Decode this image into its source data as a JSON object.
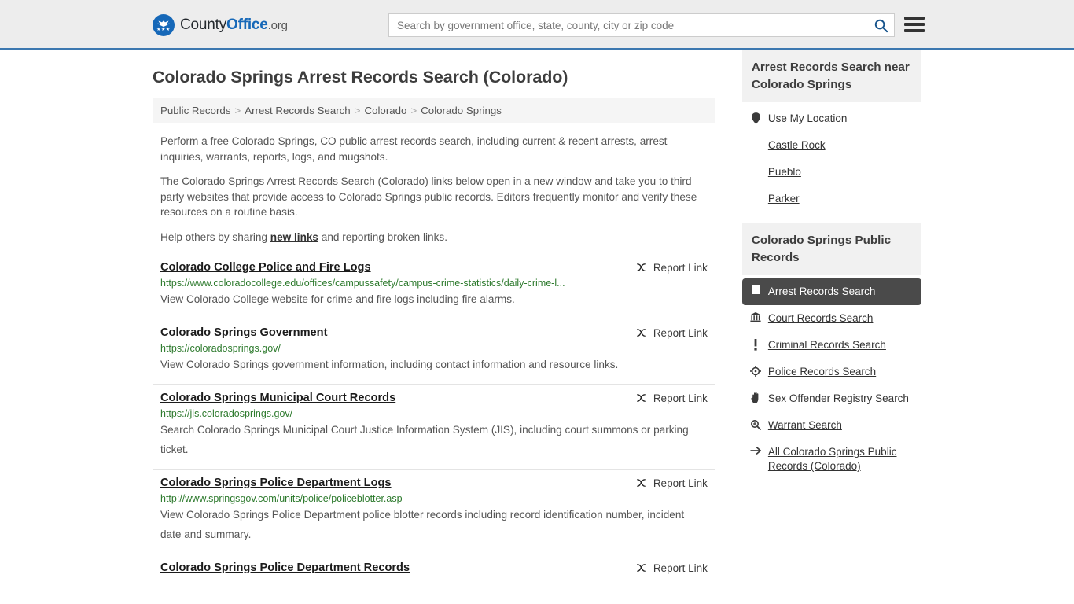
{
  "header": {
    "brand": {
      "part1": "County",
      "part2": "Office",
      "part3": ".org",
      "logo_icon": "eagle-shield-icon",
      "stars": "★★★"
    },
    "search": {
      "placeholder": "Search by government office, state, county, city or zip code",
      "value": "",
      "icon": "search-icon"
    },
    "menu": {
      "icon": "hamburger-menu-icon"
    },
    "accent_color": "#1668b8",
    "border_color": "#3c78b0"
  },
  "main": {
    "title": "Colorado Springs Arrest Records Search (Colorado)",
    "breadcrumb": [
      {
        "label": "Public Records"
      },
      {
        "label": "Arrest Records Search"
      },
      {
        "label": "Colorado"
      },
      {
        "label": "Colorado Springs"
      }
    ],
    "breadcrumb_separator": ">",
    "intro": {
      "p1": "Perform a free Colorado Springs, CO public arrest records search, including current & recent arrests, arrest inquiries, warrants, reports, logs, and mugshots.",
      "p2": "The Colorado Springs Arrest Records Search (Colorado) links below open in a new window and take you to third party websites that provide access to Colorado Springs public records. Editors frequently monitor and verify these resources on a routine basis.",
      "p3_before": "Help others by sharing ",
      "p3_link": "new links",
      "p3_after": " and reporting broken links."
    },
    "report_link_label": "Report Link",
    "report_link_icon": "broken-link-icon",
    "results": [
      {
        "title": "Colorado College Police and Fire Logs",
        "url": "https://www.coloradocollege.edu/offices/campussafety/campus-crime-statistics/daily-crime-l...",
        "description": "View Colorado College website for crime and fire logs including fire alarms."
      },
      {
        "title": "Colorado Springs Government",
        "url": "https://coloradosprings.gov/",
        "description": "View Colorado Springs government information, including contact information and resource links."
      },
      {
        "title": "Colorado Springs Municipal Court Records",
        "url": "https://jis.coloradosprings.gov/",
        "description": "Search Colorado Springs Municipal Court Justice Information System (JIS), including court summons or parking ticket."
      },
      {
        "title": "Colorado Springs Police Department Logs",
        "url": "http://www.springsgov.com/units/police/policeblotter.asp",
        "description": "View Colorado Springs Police Department police blotter records including record identification number, incident date and summary."
      },
      {
        "title": "Colorado Springs Police Department Records",
        "url": "",
        "description": ""
      }
    ]
  },
  "sidebar": {
    "nearby": {
      "heading": "Arrest Records Search near Colorado Springs",
      "items": [
        {
          "label": "Use My Location",
          "icon": "map-pin-icon"
        },
        {
          "label": "Castle Rock",
          "icon": ""
        },
        {
          "label": "Pueblo",
          "icon": ""
        },
        {
          "label": "Parker",
          "icon": ""
        }
      ]
    },
    "public_records": {
      "heading": "Colorado Springs Public Records",
      "items": [
        {
          "label": "Arrest Records Search",
          "icon": "square-icon",
          "active": true
        },
        {
          "label": "Court Records Search",
          "icon": "bank-icon",
          "active": false
        },
        {
          "label": "Criminal Records Search",
          "icon": "exclamation-icon",
          "active": false
        },
        {
          "label": "Police Records Search",
          "icon": "target-icon",
          "active": false
        },
        {
          "label": "Sex Offender Registry Search",
          "icon": "hand-icon",
          "active": false
        },
        {
          "label": "Warrant Search",
          "icon": "magnifier-plus-icon",
          "active": false
        },
        {
          "label": "All Colorado Springs Public Records (Colorado)",
          "icon": "arrow-right-icon",
          "active": false
        }
      ],
      "active_bg": "#4a4a4a"
    }
  }
}
